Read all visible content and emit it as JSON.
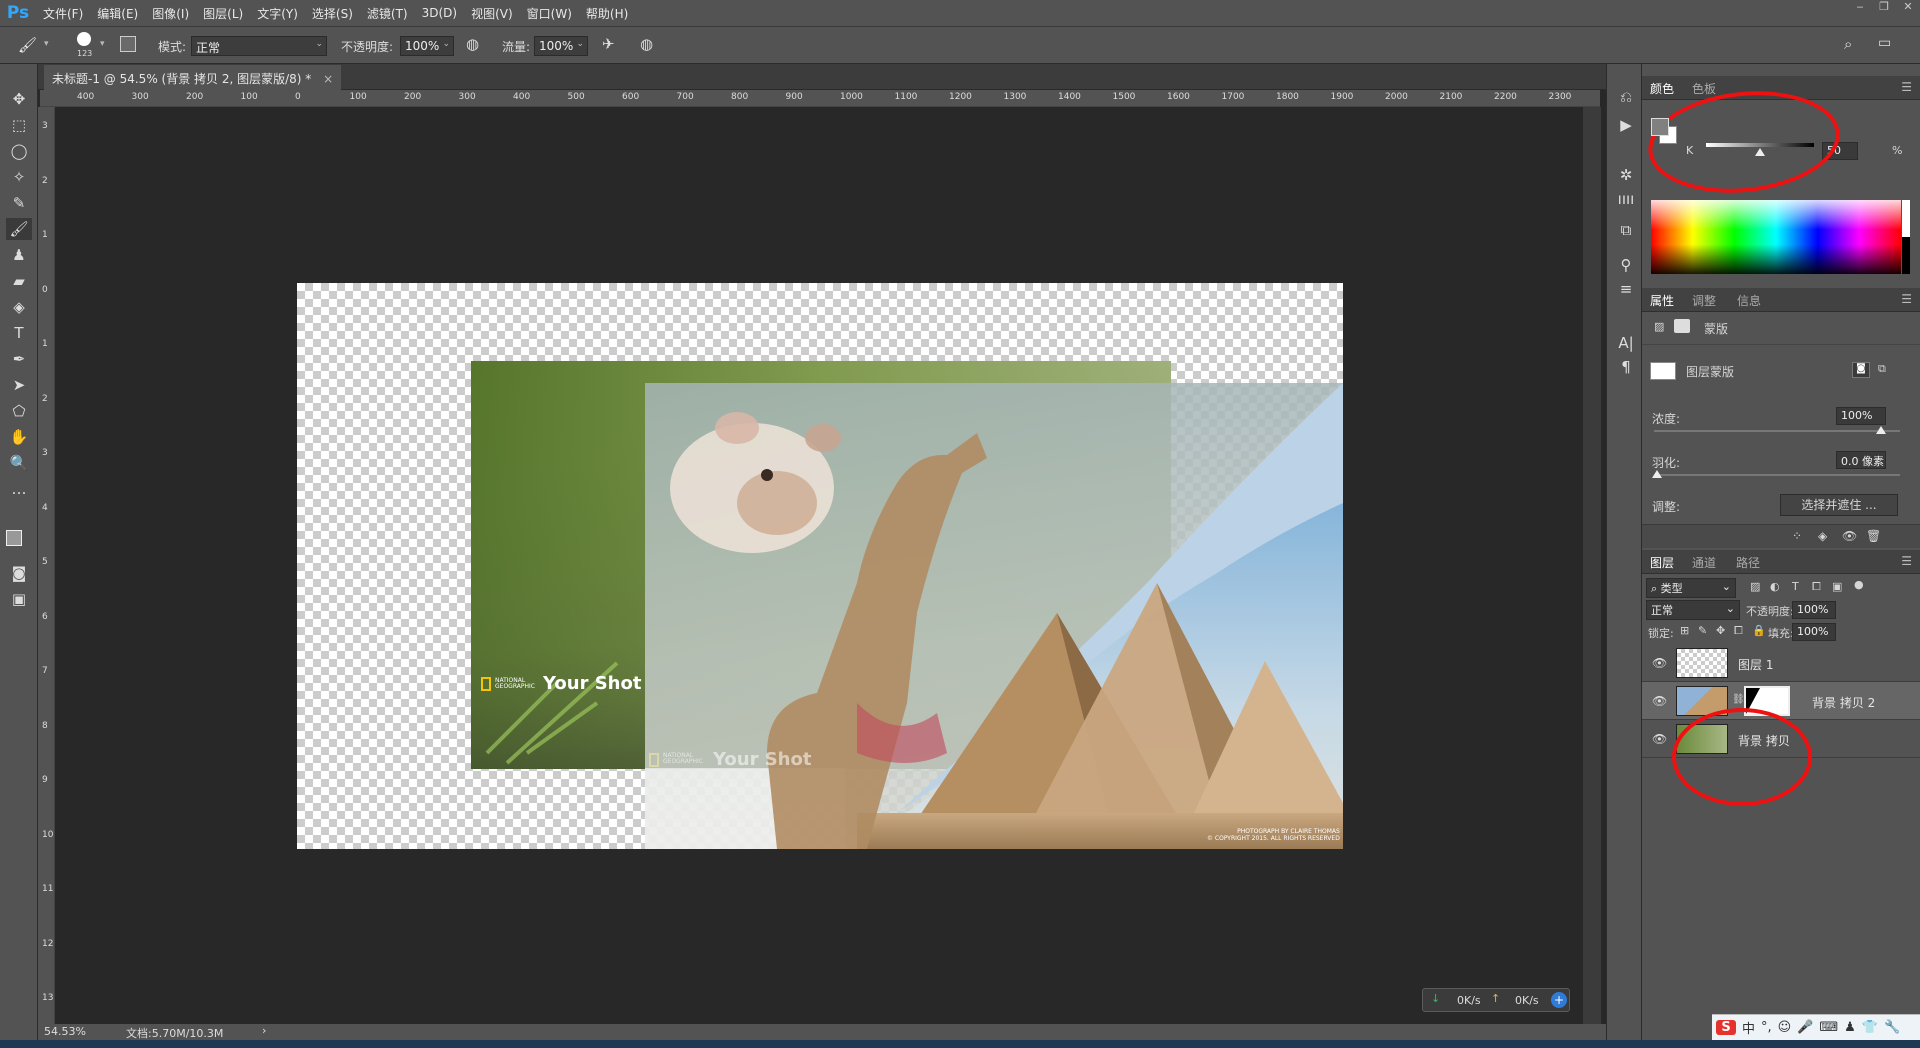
{
  "app": {
    "logo": "Ps"
  },
  "menu": [
    "文件(F)",
    "编辑(E)",
    "图像(I)",
    "图层(L)",
    "文字(Y)",
    "选择(S)",
    "滤镜(T)",
    "3D(D)",
    "视图(V)",
    "窗口(W)",
    "帮助(H)"
  ],
  "window_controls": [
    "‒",
    "❐",
    "✕"
  ],
  "options": {
    "brush_size": "123",
    "mode_label": "模式:",
    "mode_value": "正常",
    "opacity_label": "不透明度:",
    "opacity_value": "100%",
    "flow_label": "流量:",
    "flow_value": "100%"
  },
  "document": {
    "tab_title": "未标题-1 @ 54.5% (背景 拷贝 2, 图层蒙版/8) *",
    "close": "×"
  },
  "ruler": {
    "h_ticks": [
      "400",
      "300",
      "200",
      "100",
      "0",
      "100",
      "200",
      "300",
      "400",
      "500",
      "600",
      "700",
      "800",
      "900",
      "1000",
      "1100",
      "1200",
      "1300",
      "1400",
      "1500",
      "1600",
      "1700",
      "1800",
      "1900",
      "2000",
      "2100",
      "2200",
      "2300"
    ],
    "v_ticks": [
      "3",
      "2",
      "1",
      "0",
      "1",
      "2",
      "3",
      "4",
      "5",
      "6",
      "7",
      "8",
      "9",
      "10",
      "11",
      "12",
      "13",
      "14"
    ]
  },
  "status": {
    "zoom": "54.53%",
    "doc": "文档:5.70M/10.3M",
    "arrow": "›"
  },
  "net": {
    "down": "0K/s",
    "up": "0K/s"
  },
  "canvas_image": {
    "brand_small": "NATIONAL GEOGRAPHIC",
    "brand_big": "Your Shot",
    "credit_line1": "PHOTOGRAPH BY CLAIRE THOMAS",
    "credit_line2": "© COPYRIGHT 2015. ALL RIGHTS RESERVED"
  },
  "color_panel": {
    "tabs": [
      "颜色",
      "色板"
    ],
    "channel": "K",
    "value": "50",
    "unit": "%",
    "level": 0.5
  },
  "properties_panel": {
    "tabs": [
      "属性",
      "调整",
      "信息"
    ],
    "section": "蒙版",
    "mask_label": "图层蒙版",
    "density_label": "浓度:",
    "density_value": "100%",
    "feather_label": "羽化:",
    "feather_value": "0.0 像素",
    "adjust_label": "调整:",
    "select_button": "选择并遮住 ..."
  },
  "layers_panel": {
    "tabs": [
      "图层",
      "通道",
      "路径"
    ],
    "filter": "类型",
    "blend": "正常",
    "opacity_label": "不透明度:",
    "opacity_value": "100%",
    "lock_label": "锁定:",
    "fill_label": "填充:",
    "fill_value": "100%",
    "layers": [
      {
        "name": "图层 1"
      },
      {
        "name": "背景 拷贝 2"
      },
      {
        "name": "背景 拷贝"
      }
    ]
  },
  "ime": {
    "logo": "S",
    "lang": "中",
    "punct": "°,"
  },
  "colors": {
    "ps_blue": "#31a8ff",
    "annotation_red": "#ee1111",
    "ui_gray": "#535353",
    "canvas_bg": "#282828"
  }
}
